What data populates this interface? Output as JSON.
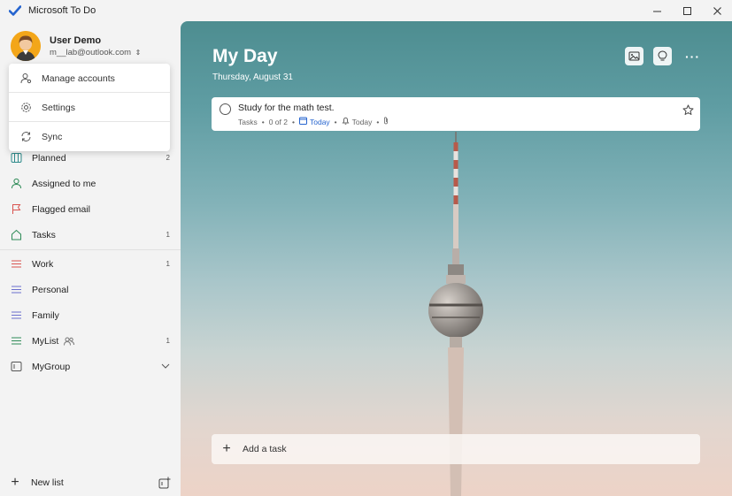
{
  "window": {
    "title": "Microsoft To Do",
    "controls": {
      "minimize": "—",
      "maximize": "☐",
      "close": "✕"
    }
  },
  "user": {
    "name": "User Demo",
    "email": "m__lab@outlook.com",
    "email_chevron": "⌃⌄"
  },
  "account_menu": {
    "items": [
      {
        "label": "Manage accounts",
        "icon": "manage-accounts-icon"
      },
      {
        "label": "Settings",
        "icon": "gear-icon"
      },
      {
        "label": "Sync",
        "icon": "sync-icon"
      }
    ]
  },
  "sidebar": {
    "smart_lists": [
      {
        "label": "Planned",
        "count": "2",
        "icon": "calendar-grid-icon"
      },
      {
        "label": "Assigned to me",
        "count": "",
        "icon": "person-icon"
      },
      {
        "label": "Flagged email",
        "count": "",
        "icon": "flag-icon"
      },
      {
        "label": "Tasks",
        "count": "1",
        "icon": "home-icon"
      }
    ],
    "lists": [
      {
        "label": "Work",
        "count": "1",
        "icon": "list-icon",
        "color": "#d9534f"
      },
      {
        "label": "Personal",
        "count": "",
        "icon": "list-icon",
        "color": "#6b6fce"
      },
      {
        "label": "Family",
        "count": "",
        "icon": "list-icon",
        "color": "#6b6fce"
      },
      {
        "label": "MyList",
        "count": "1",
        "icon": "list-icon",
        "color": "#2e8b57"
      },
      {
        "label": "MyGroup",
        "count": "",
        "icon": "group-icon"
      }
    ],
    "new_list_label": "New list"
  },
  "main": {
    "title": "My Day",
    "date": "Thursday, August 31",
    "tasks": [
      {
        "title": "Study for the math test.",
        "list": "Tasks",
        "steps": "0 of 2",
        "due": "Today",
        "reminder": "Today"
      }
    ],
    "add_task_label": "Add a task"
  },
  "colors": {
    "accent": "#2564cf",
    "sidebar_bg": "#f3f3f3"
  }
}
